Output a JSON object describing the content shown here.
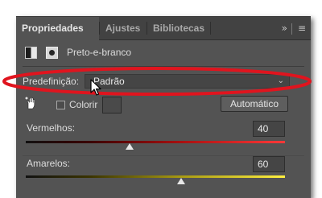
{
  "tabs": [
    {
      "label": "Propriedades",
      "active": true
    },
    {
      "label": "Ajustes",
      "active": false
    },
    {
      "label": "Bibliotecas",
      "active": false
    }
  ],
  "panel_menu": {
    "collapse_glyph": "»",
    "menu_glyph": "≡"
  },
  "adjustment": {
    "title": "Preto-e-branco"
  },
  "preset": {
    "label": "Predefinição:",
    "value": "Padrão"
  },
  "tint": {
    "label": "Colorir",
    "checked": false
  },
  "auto_button": {
    "label": "Automático"
  },
  "sliders": [
    {
      "label": "Vermelhos:",
      "value": "40",
      "level": 0.4
    },
    {
      "label": "Amarelos:",
      "value": "60",
      "level": 0.6
    }
  ],
  "colors": {
    "panel_bg": "#535353",
    "tabbar_bg": "#424242",
    "highlight_ellipse": "#e0141e"
  }
}
